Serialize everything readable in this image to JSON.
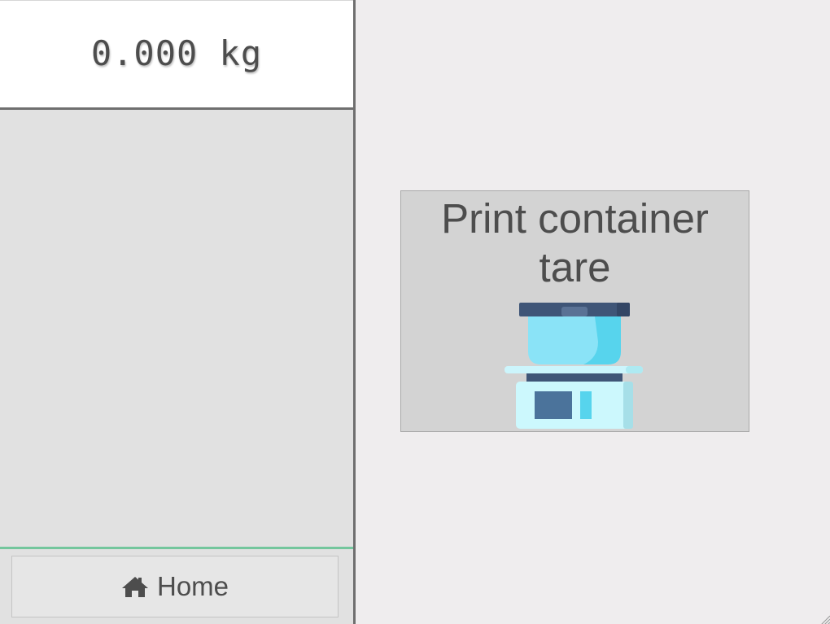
{
  "scale": {
    "weight_display": "0.000 kg"
  },
  "navigation": {
    "home_label": "Home",
    "home_icon": "home-icon"
  },
  "actions": {
    "print_container_tare_label": "Print container tare",
    "print_container_tare_icon": "kitchen-scale-icon"
  },
  "colors": {
    "accent_divider": "#74c69d",
    "panel_border": "#6f6f6f",
    "text": "#4d4d4d"
  }
}
